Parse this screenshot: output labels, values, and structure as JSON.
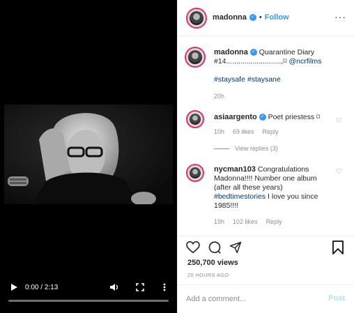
{
  "video": {
    "time": "0:00 / 2:13",
    "progress": 0,
    "icons": {
      "play": "play-icon",
      "volume": "volume-icon",
      "fullscreen": "fullscreen-icon",
      "more": "more-vertical-icon"
    }
  },
  "header": {
    "username": "madonna",
    "separator": "•",
    "follow_label": "Follow",
    "more_label": "···"
  },
  "caption": {
    "username": "madonna",
    "text": "Quarantine Diary #14...........................,⌑",
    "mention": "@ncrfilms",
    "hashtags": "#staysafe #staysane",
    "time": "20h"
  },
  "comments": [
    {
      "username": "asiaargento",
      "text": "Poet priestess ⌑",
      "time": "10h",
      "likes": "69 likes",
      "reply_label": "Reply",
      "verified": true
    },
    {
      "username": "nycman103",
      "text": "Congratulations Madonna!!!! Number one album (after all these years)",
      "hashtag": "#bedtimestories",
      "text_after": "I love you since 1985!!!!",
      "time": "19h",
      "likes": "102 likes",
      "reply_label": "Reply",
      "verified": false
    }
  ],
  "view_replies": "View replies (3)",
  "actions": {
    "views": "250,700 views",
    "ago": "20 HOURS AGO"
  },
  "comment_input": {
    "placeholder": "Add a comment...",
    "post_label": "Post"
  },
  "colors": {
    "link": "#3897f0",
    "post_disabled": "#b2dffc",
    "story_ring": "#e1306c"
  }
}
